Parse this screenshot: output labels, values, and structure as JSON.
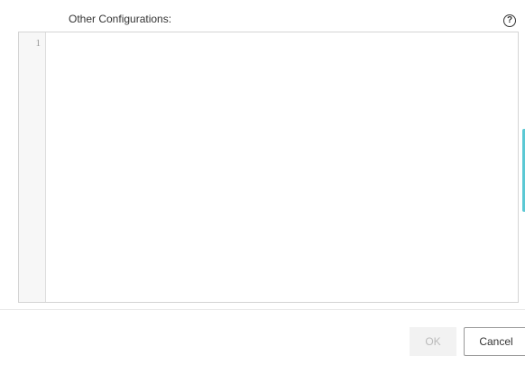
{
  "form": {
    "label": "Other Configurations:",
    "help_icon": "question-circle-icon",
    "help_glyph": "?"
  },
  "editor": {
    "line_numbers": [
      "1"
    ],
    "content": ""
  },
  "footer": {
    "ok_label": "OK",
    "ok_disabled": true,
    "cancel_label": "Cancel"
  }
}
